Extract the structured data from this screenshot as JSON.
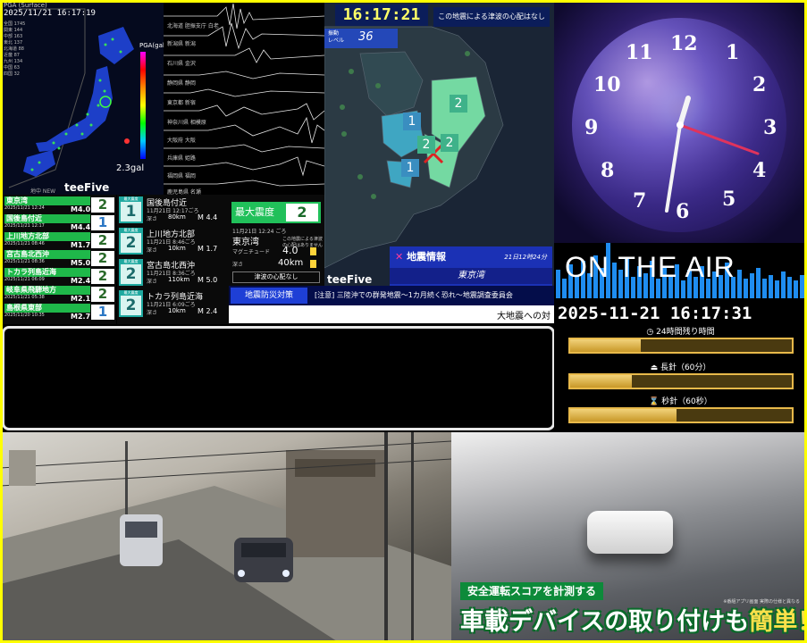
{
  "japan": {
    "panel_title": "PGA (Surface)",
    "timestamp": "2025/11/21 16:17:19",
    "stats": [
      "全国 1745",
      "関東 144",
      "中部 163",
      "東北 137",
      "北海道 88",
      "近畿 87",
      "九州 134",
      "中国 63",
      "四国 32"
    ],
    "scale_label": "PGA(gal)",
    "gal": "2.3gal",
    "credit": "地中 NEW",
    "logo": "teeFive"
  },
  "seismo": {
    "stations": [
      "北海道 胆振支庁 白老",
      "新潟県 新潟",
      "石川県 金沢",
      "静岡県 静岡",
      "東京都 新宿",
      "神奈川県 相模原",
      "大阪府 大阪",
      "兵庫県 姫路",
      "福岡県 福岡",
      "鹿児島県 名瀬"
    ]
  },
  "shindo_list": [
    {
      "place": "東京湾",
      "date": "2025/11/21 12:24",
      "mag": "M4.0",
      "intensity": "2"
    },
    {
      "place": "国後島付近",
      "date": "2025/11/21 12:17",
      "mag": "M4.4",
      "intensity": "1"
    },
    {
      "place": "上川地方北部",
      "date": "2025/11/21 08:46",
      "mag": "M1.7",
      "intensity": "2"
    },
    {
      "place": "宮古島北西沖",
      "date": "2025/11/21 08:36",
      "mag": "M5.0",
      "intensity": "2"
    },
    {
      "place": "トカラ列島近海",
      "date": "2025/11/21 06:09",
      "mag": "M2.4",
      "intensity": "2"
    },
    {
      "place": "岐阜県飛騨地方",
      "date": "2025/11/21 05:38",
      "mag": "M2.1",
      "intensity": "2"
    },
    {
      "place": "島根県東部",
      "date": "2025/11/20 10:35",
      "mag": "M2.7",
      "intensity": "1"
    }
  ],
  "detail_list": [
    {
      "badge": "最大震度",
      "value": "1",
      "name": "国後島付近",
      "time": "11月21日 12:17ごろ",
      "depth_label": "深さ",
      "depth": "80km",
      "mag": "M 4.4"
    },
    {
      "badge": "最大震度",
      "value": "2",
      "name": "上川地方北部",
      "time": "11月21日 8:46ごろ",
      "depth_label": "深さ",
      "depth": "10km",
      "mag": "M 1.7"
    },
    {
      "badge": "最大震度",
      "value": "2",
      "name": "宮古島北西沖",
      "time": "11月21日 8:36ごろ",
      "depth_label": "深さ",
      "depth": "110km",
      "mag": "M 5.0"
    },
    {
      "badge": "最大震度",
      "value": "2",
      "name": "トカラ列島近海",
      "time": "11月21日 6:09ごろ",
      "depth_label": "深さ",
      "depth": "10km",
      "mag": "M 2.4"
    }
  ],
  "max_panel": {
    "label": "最大震度",
    "value": "2",
    "time": "11月21日 12:24 ごろ",
    "location": "東京湾",
    "location_note": "この地震による津波の心配はありません",
    "mag_label": "マグニチュード",
    "mag": "4.0",
    "depth_label": "深さ",
    "depth": "40km",
    "tsunami": "津波の心配なし"
  },
  "kanto": {
    "clock": "16:17:21",
    "level_label": "振動\nレベル",
    "level": "36",
    "tsunami_note": "この地震による津波の心配はなし",
    "logo": "teeFive",
    "markers": [
      "2",
      "1",
      "2",
      "2",
      "1"
    ]
  },
  "quake_info": {
    "title": "地震情報",
    "date": "21日12時24分",
    "place": "東京湾"
  },
  "ticker": {
    "tag": "地震防災対策",
    "text": "[注意] 三陸沖での群発地震～1カ月続く恐れ～地震調査委員会",
    "text2": "大地震への対"
  },
  "clock_face": {
    "numerals": [
      "12",
      "1",
      "2",
      "3",
      "4",
      "5",
      "6",
      "7",
      "8",
      "9",
      "10",
      "11"
    ],
    "time": "16:17:31"
  },
  "onair": {
    "text": "ON THE AIR"
  },
  "datetime": {
    "value": "2025-11-21 16:17:31",
    "bars": [
      {
        "label": "◷ 24時間残り時間",
        "fraction": 0.32
      },
      {
        "label": "⏏ 長針（60分）",
        "fraction": 0.28
      },
      {
        "label": "⌛ 秒針（60秒）",
        "fraction": 0.48
      }
    ]
  },
  "cam2": {
    "caption1": "安全運転スコアを計測する",
    "caption2_a": "車載デバイスの取り付けも",
    "caption2_b": "簡単！",
    "note": "※番組アプリ画面 実際の仕様と異なる"
  }
}
